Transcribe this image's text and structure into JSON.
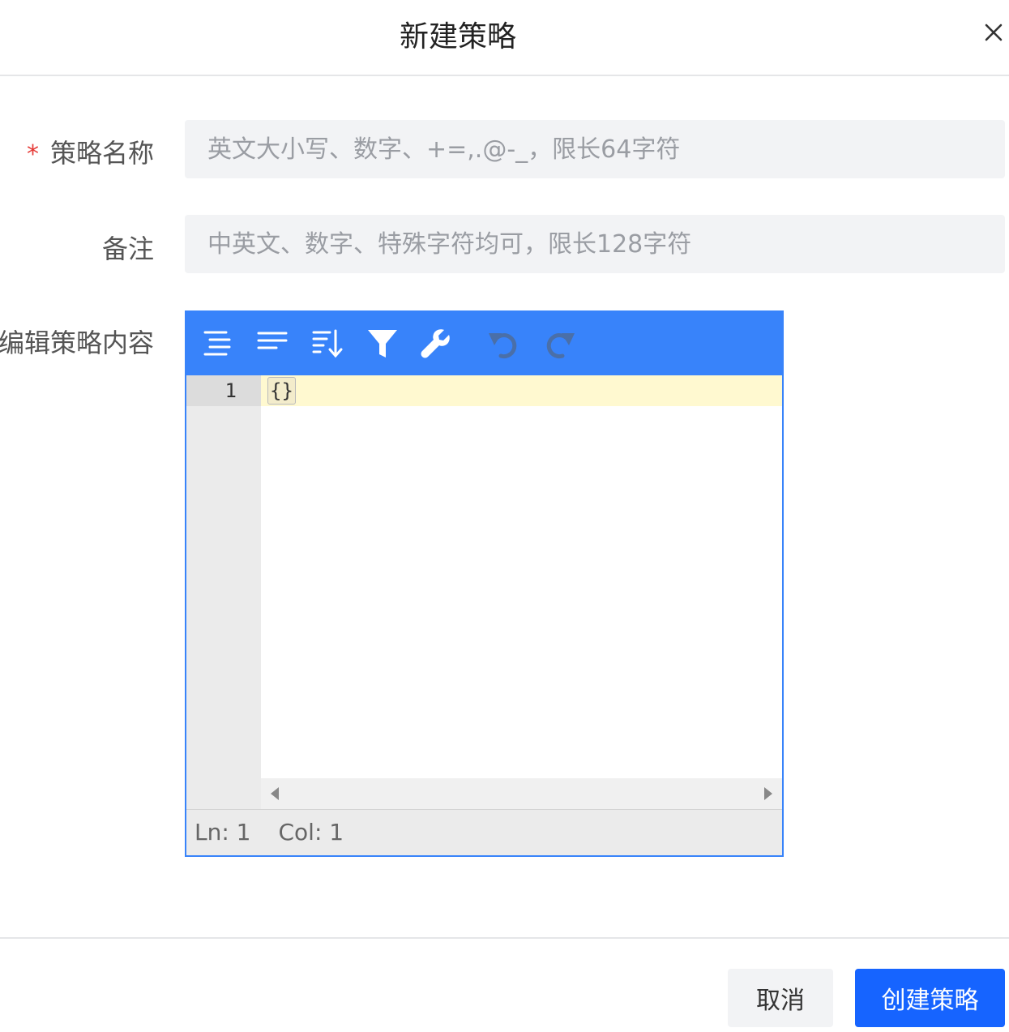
{
  "dialog": {
    "title": "新建策略",
    "close_icon": "close-icon"
  },
  "form": {
    "name": {
      "required_mark": "*",
      "label": "策略名称",
      "value": "",
      "placeholder": "英文大小写、数字、+=,.@-_，限长64字符"
    },
    "remark": {
      "label": "备注",
      "value": "",
      "placeholder": "中英文、数字、特殊字符均可，限长128字符"
    },
    "content": {
      "label": "编辑策略内容"
    }
  },
  "editor": {
    "toolbar": {
      "icons": [
        "format-icon",
        "compact-icon",
        "sort-icon",
        "filter-icon",
        "repair-icon",
        "undo-icon",
        "redo-icon"
      ]
    },
    "line_number": "1",
    "code": "{}",
    "status": {
      "line": "Ln: 1",
      "col": "Col: 1"
    },
    "colors": {
      "toolbar": "#3883fa",
      "active_line": "#fff9d0"
    }
  },
  "footer": {
    "cancel_label": "取消",
    "create_label": "创建策略",
    "primary_color": "#1664ff"
  }
}
